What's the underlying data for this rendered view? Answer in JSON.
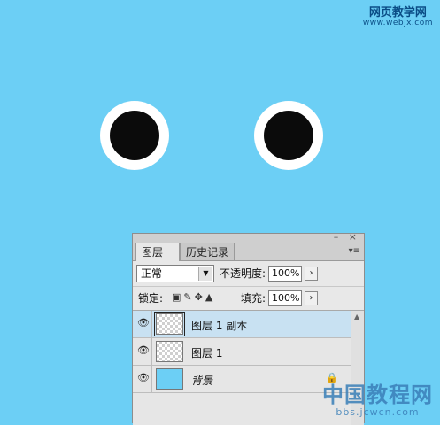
{
  "watermark_top": {
    "text": "网页教学网",
    "url": "www.webjx.com"
  },
  "watermark_bottom": {
    "text": "中国教程网",
    "url": "bbs.jcwcn.com"
  },
  "tabs": [
    {
      "label": "图层",
      "close": "×"
    },
    {
      "label": "历史记录"
    }
  ],
  "window_buttons": "– ×",
  "menu_icon": "▾≡",
  "blend_mode": "正常",
  "opacity": {
    "label": "不透明度:",
    "value": "100%"
  },
  "lock": {
    "label": "锁定:",
    "icons": [
      "lock-transparent-icon",
      "lock-image-icon",
      "lock-position-icon",
      "lock-all-icon"
    ]
  },
  "fill": {
    "label": "填充:",
    "value": "100%"
  },
  "layers": [
    {
      "name": "图层 1 副本",
      "selected": true
    },
    {
      "name": "图层 1",
      "selected": false
    },
    {
      "name": "背景",
      "selected": false,
      "locked": true
    }
  ],
  "colors": {
    "background": "#6ccff5",
    "selection": "#c8e1f2"
  }
}
